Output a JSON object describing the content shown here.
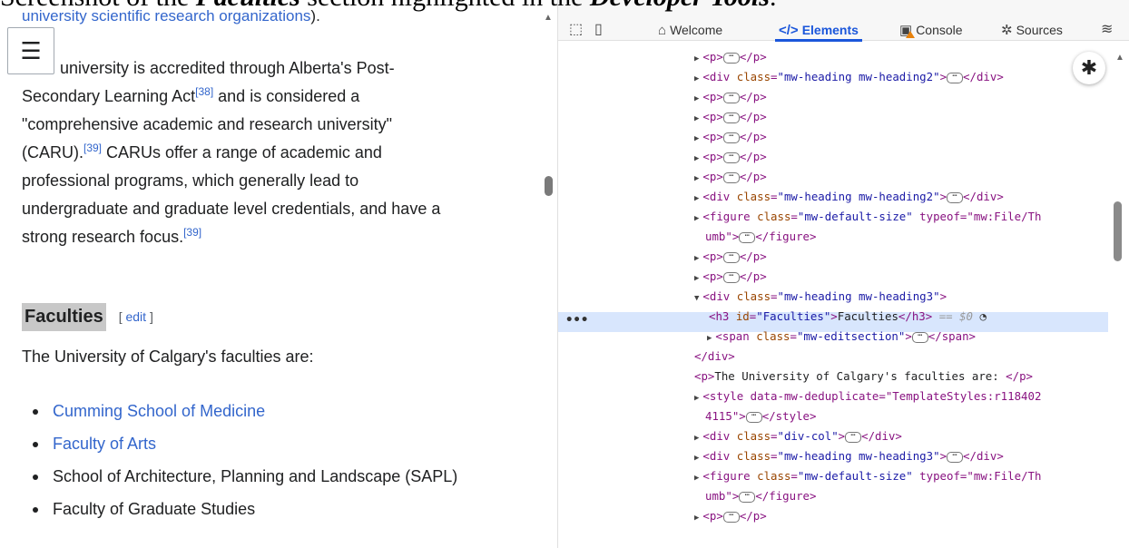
{
  "caption": {
    "prefix": "Screenshot of the ",
    "emph": "Faculties",
    "suffix": " section highlighted in the ",
    "emph2": "Developer Tools",
    "end": "."
  },
  "wiki": {
    "top_link": "university scientific research organizations",
    "top_tail": ").",
    "para_l1": "university is accredited through Alberta's Post-",
    "para_l2": "Secondary Learning Act",
    "ref38": "[38]",
    "para_l2b": " and is considered a",
    "para_l3": "\"comprehensive academic and research university\"",
    "para_l4": "(CARU).",
    "ref39a": "[39]",
    "para_l4b": " CARUs offer a range of academic and",
    "para_l5": "professional programs, which generally lead to",
    "para_l6": "undergraduate and graduate level credentials, and have a",
    "para_l7": "strong research focus.",
    "ref39b": "[39]",
    "section_title": "Faculties",
    "edit_open": "[ ",
    "edit_label": "edit",
    "edit_close": " ]",
    "intro": "The University of Calgary's faculties are:",
    "faculties": [
      {
        "name": "Cumming School of Medicine"
      },
      {
        "name": "Faculty of Arts"
      },
      {
        "name": "School of Architecture, Planning and Landscape (SAPL)"
      },
      {
        "name": "Faculty of Graduate Studies"
      }
    ]
  },
  "devtools": {
    "tabs": [
      {
        "label": "Welcome",
        "icon": "home-icon"
      },
      {
        "label": "Elements",
        "icon": "code-icon"
      },
      {
        "label": "Console",
        "icon": "console-icon"
      },
      {
        "label": "Sources",
        "icon": "bug-icon"
      }
    ],
    "dom_lines": [
      {
        "t": "<p>",
        "c": "</p>"
      },
      {
        "t": "<div class=\"mw-heading mw-heading2\">",
        "c": "</div>"
      },
      {
        "t": "<p>",
        "c": "</p>"
      },
      {
        "t": "<p>",
        "c": "</p>"
      },
      {
        "t": "<p>",
        "c": "</p>"
      },
      {
        "t": "<p>",
        "c": "</p>"
      },
      {
        "t": "<p>",
        "c": "</p>"
      },
      {
        "t": "<div class=\"mw-heading mw-heading2\">",
        "c": "</div>"
      },
      {
        "t": "<figure class=\"mw-default-size\" typeof=\"mw:File/Th",
        "t2": "umb\">",
        "c": "</figure>"
      },
      {
        "t": "<p>",
        "c": "</p>"
      },
      {
        "t": "<p>",
        "c": "</p>"
      },
      {
        "t": "<div class=\"mw-heading mw-heading3\">"
      },
      {
        "t": "<h3 id=\"Faculties\">Faculties</h3>",
        "eq": "== $0"
      },
      {
        "t": "<span class=\"mw-editsection\">",
        "c": "</span>"
      },
      {
        "t": "</div>"
      },
      {
        "t": "<p>The University of Calgary's faculties are: </p>"
      },
      {
        "t": "<style data-mw-deduplicate=\"TemplateStyles:r118402",
        "t2": "4115\">",
        "c": "</style>"
      },
      {
        "t": "<div class=\"div-col\">",
        "c": "</div>"
      },
      {
        "t": "<div class=\"mw-heading mw-heading3\">",
        "c": "</div>"
      },
      {
        "t": "<figure class=\"mw-default-size\" typeof=\"mw:File/Th",
        "t2": "umb\">",
        "c": "</figure>"
      },
      {
        "t": "<p>",
        "c": "</p>"
      }
    ]
  }
}
